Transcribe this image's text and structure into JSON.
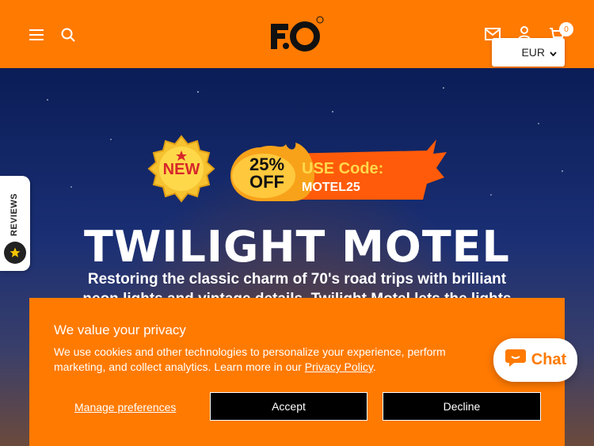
{
  "header": {
    "menu_icon": "hamburger-icon",
    "search_icon": "search-icon",
    "logo_text": "F.O",
    "mail_icon": "mail-icon",
    "account_icon": "user-icon",
    "cart_icon": "cart-icon",
    "cart_count": "0",
    "currency": "EUR"
  },
  "hero": {
    "badge_new": "NEW",
    "promo_discount_line1": "25%",
    "promo_discount_line2": "OFF",
    "promo_use_code": "USE Code:",
    "promo_code": "MOTEL25",
    "title": "TWILIGHT MOTEL",
    "subtitle": "Restoring the classic charm of 70's road trips with brilliant neon lights and vintage details, Twilight Motel lets the lights"
  },
  "reviews_tab": {
    "label": "REVIEWS",
    "icon": "star-icon"
  },
  "cookie_banner": {
    "title": "We value your privacy",
    "text": "We use cookies and other technologies to personalize your experience, perform marketing, and collect analytics. Learn more in our",
    "link": "Privacy Policy",
    "link_suffix": ".",
    "manage": "Manage preferences",
    "accept": "Accept",
    "decline": "Decline"
  },
  "chat": {
    "label": "Chat",
    "icon": "chat-bubble-icon"
  },
  "colors": {
    "brand": "#ff7a00",
    "button_bg": "#000000"
  }
}
